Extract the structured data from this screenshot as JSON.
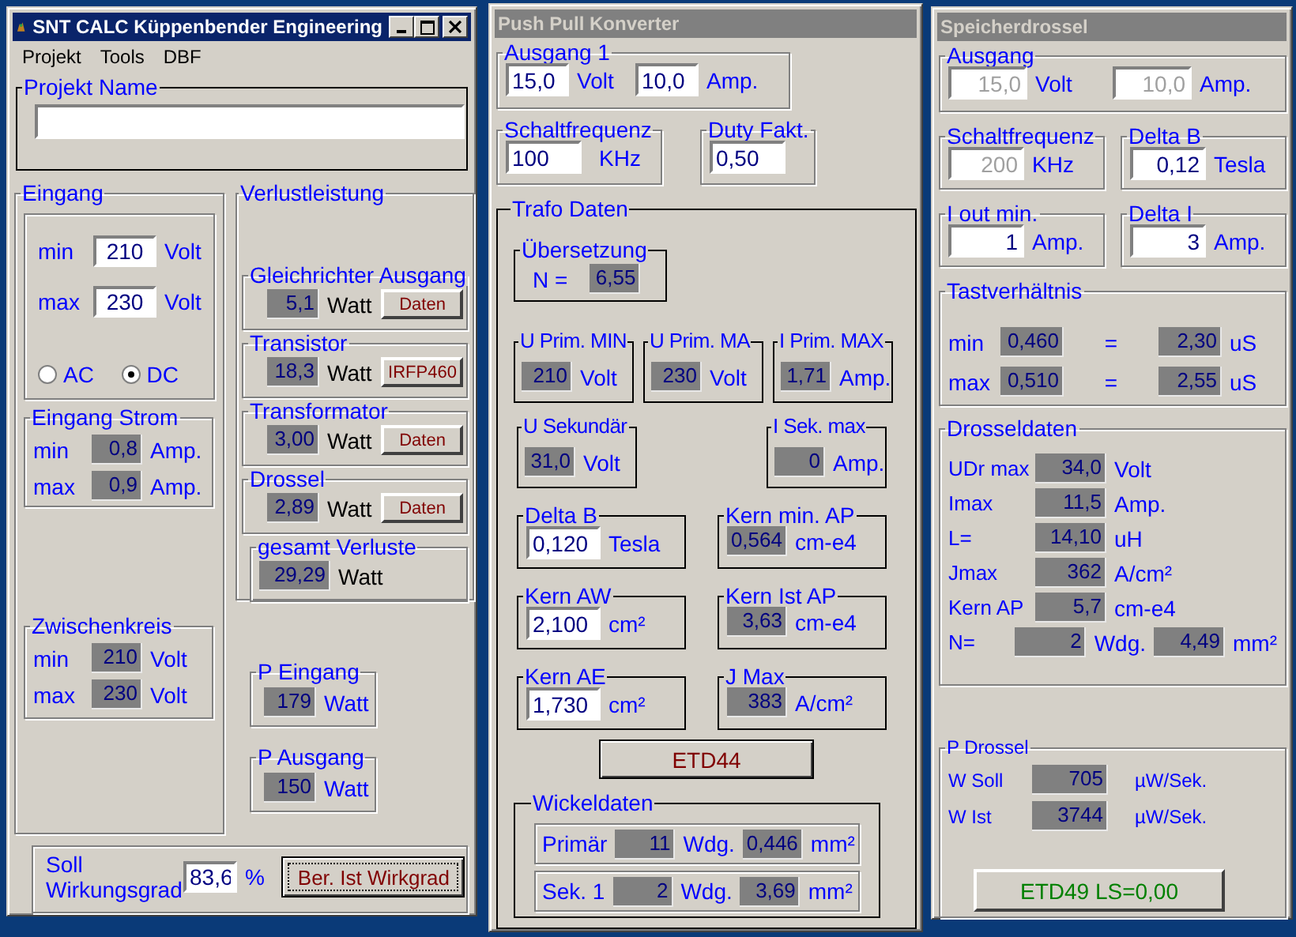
{
  "main_window": {
    "title": "SNT CALC  Küppenbender Engineering",
    "active": true,
    "menu": [
      "Projekt",
      "Tools",
      "DBF"
    ],
    "projekt_name": {
      "title": "Projekt Name"
    },
    "eingang": {
      "title": "Eingang",
      "rows": [
        [
          {
            "kind": "label",
            "text": "min"
          },
          {
            "kind": "input",
            "value": "210",
            "disabled": false
          },
          {
            "kind": "unit",
            "text": "Volt"
          }
        ],
        [
          {
            "kind": "label",
            "text": "max"
          },
          {
            "kind": "input",
            "value": "230",
            "disabled": false
          },
          {
            "kind": "unit",
            "text": "Volt"
          }
        ]
      ],
      "radios": [
        {
          "kind": "radio",
          "text": "AC",
          "selected": false
        },
        {
          "kind": "radio",
          "text": "DC",
          "selected": true
        }
      ]
    },
    "eingang_strom": {
      "title": "Eingang Strom",
      "rows": [
        [
          {
            "kind": "label",
            "text": "min"
          },
          {
            "kind": "output",
            "value": "0,8"
          },
          {
            "kind": "unit",
            "text": "Amp."
          }
        ],
        [
          {
            "kind": "label",
            "text": "max"
          },
          {
            "kind": "output",
            "value": "0,9"
          },
          {
            "kind": "unit",
            "text": "Amp."
          }
        ]
      ]
    },
    "zwischenkreis": {
      "title": "Zwischenkreis",
      "rows": [
        [
          {
            "kind": "label",
            "text": "min"
          },
          {
            "kind": "output",
            "value": "210"
          },
          {
            "kind": "unit",
            "text": "Volt"
          }
        ],
        [
          {
            "kind": "label",
            "text": "max"
          },
          {
            "kind": "output",
            "value": "230"
          },
          {
            "kind": "unit",
            "text": "Volt"
          }
        ]
      ]
    },
    "verlustleistung": {
      "title": "Verlustleistung",
      "groups": [
        {
          "title": "Gleichrichter Ausgang",
          "rows": [
            [
              {
                "kind": "output",
                "value": "5,1"
              },
              {
                "kind": "unit",
                "text": "Watt"
              },
              {
                "kind": "button",
                "text": "Daten",
                "color": "#800000",
                "focused": false
              }
            ]
          ]
        },
        {
          "title": "Transistor",
          "rows": [
            [
              {
                "kind": "output",
                "value": "18,3"
              },
              {
                "kind": "unit",
                "text": "Watt"
              },
              {
                "kind": "button",
                "text": "IRFP460",
                "color": "#800000",
                "focused": false
              }
            ]
          ]
        },
        {
          "title": "Transformator",
          "rows": [
            [
              {
                "kind": "output",
                "value": "3,00"
              },
              {
                "kind": "unit",
                "text": "Watt"
              },
              {
                "kind": "button",
                "text": "Daten",
                "color": "#800000",
                "focused": false
              }
            ]
          ]
        },
        {
          "title": "Drossel",
          "rows": [
            [
              {
                "kind": "output",
                "value": "2,89"
              },
              {
                "kind": "unit",
                "text": "Watt"
              },
              {
                "kind": "button",
                "text": "Daten",
                "color": "#800000",
                "focused": false
              }
            ]
          ]
        },
        {
          "title": "gesamt Verluste",
          "rows": [
            [
              {
                "kind": "output",
                "value": "29,29"
              },
              {
                "kind": "unit",
                "text": "Watt"
              }
            ]
          ]
        }
      ]
    },
    "leistung": [
      {
        "title": "P Eingang",
        "rows": [
          [
            {
              "kind": "output",
              "value": "179"
            },
            {
              "kind": "unit",
              "text": "Watt"
            }
          ]
        ]
      },
      {
        "title": "P Ausgang",
        "rows": [
          [
            {
              "kind": "output",
              "value": "150"
            },
            {
              "kind": "unit",
              "text": "Watt"
            }
          ]
        ]
      }
    ],
    "wirkungsgrad": {
      "rows": [
        [
          {
            "kind": "label",
            "text": "Soll Wirkungsgrad"
          },
          {
            "kind": "input",
            "value": "83,6",
            "disabled": false
          },
          {
            "kind": "unit",
            "text": "%"
          },
          {
            "kind": "button",
            "text": "Ber. Ist Wirkgrad",
            "color": "#800000",
            "focused": true
          }
        ]
      ]
    }
  },
  "push_pull_window": {
    "title": "Push Pull Konverter",
    "active": false,
    "ausgang": {
      "title": "Ausgang 1",
      "rows": [
        [
          {
            "kind": "input",
            "value": "15,0",
            "disabled": false
          },
          {
            "kind": "unit",
            "text": "Volt"
          },
          {
            "kind": "input",
            "value": "10,0",
            "disabled": false
          },
          {
            "kind": "unit",
            "text": "Amp."
          }
        ]
      ]
    },
    "schaltfrequenz": {
      "title": "Schaltfrequenz",
      "rows": [
        [
          {
            "kind": "input",
            "value": "100",
            "disabled": false
          },
          {
            "kind": "unit",
            "text": "KHz"
          }
        ]
      ]
    },
    "duty": {
      "title": "Duty Fakt.",
      "rows": [
        [
          {
            "kind": "input",
            "value": "0,50",
            "disabled": false
          }
        ]
      ]
    },
    "trafo_daten": {
      "title": "Trafo  Daten",
      "uebersetzung": {
        "title": "Übersetzung",
        "rows": [
          [
            {
              "kind": "label",
              "text": "N ="
            },
            {
              "kind": "output",
              "value": "6,55"
            }
          ]
        ]
      },
      "primaer": [
        {
          "title": "U Prim. MIN",
          "rows": [
            [
              {
                "kind": "output",
                "value": "210"
              },
              {
                "kind": "unit",
                "text": "Volt"
              }
            ]
          ]
        },
        {
          "title": "U Prim. MA",
          "rows": [
            [
              {
                "kind": "output",
                "value": "230"
              },
              {
                "kind": "unit",
                "text": "Volt"
              }
            ]
          ]
        },
        {
          "title": "I Prim. MAX",
          "rows": [
            [
              {
                "kind": "output",
                "value": "1,71"
              },
              {
                "kind": "unit",
                "text": "Amp."
              }
            ]
          ]
        }
      ],
      "sekundaer": [
        {
          "title": "U Sekundär",
          "rows": [
            [
              {
                "kind": "output",
                "value": "31,0"
              },
              {
                "kind": "unit",
                "text": "Volt"
              }
            ]
          ]
        },
        {
          "title": "I Sek. max",
          "rows": [
            [
              {
                "kind": "output",
                "value": "0"
              },
              {
                "kind": "unit",
                "text": "Amp."
              }
            ]
          ]
        }
      ],
      "kern": [
        {
          "title": "Delta B",
          "rows": [
            [
              {
                "kind": "input",
                "value": "0,120",
                "disabled": false
              },
              {
                "kind": "unit",
                "text": "Tesla"
              }
            ]
          ]
        },
        {
          "title": "Kern min. AP",
          "rows": [
            [
              {
                "kind": "output",
                "value": "0,564"
              },
              {
                "kind": "unit",
                "text": "cm-e4"
              }
            ]
          ]
        },
        {
          "title": "Kern AW",
          "rows": [
            [
              {
                "kind": "input",
                "value": "2,100",
                "disabled": false
              },
              {
                "kind": "unit",
                "text": "cm²"
              }
            ]
          ]
        },
        {
          "title": "Kern Ist AP",
          "rows": [
            [
              {
                "kind": "output",
                "value": "3,63"
              },
              {
                "kind": "unit",
                "text": "cm-e4"
              }
            ]
          ]
        },
        {
          "title": "Kern AE",
          "rows": [
            [
              {
                "kind": "input",
                "value": "1,730",
                "disabled": false
              },
              {
                "kind": "unit",
                "text": "cm²"
              }
            ]
          ]
        },
        {
          "title": "J Max",
          "rows": [
            [
              {
                "kind": "output",
                "value": "383"
              },
              {
                "kind": "unit",
                "text": "A/cm²"
              }
            ]
          ]
        }
      ],
      "button": {
        "kind": "button",
        "text": "ETD44",
        "color": "#800000",
        "focused": false
      },
      "wickeldaten": {
        "title": "Wickeldaten",
        "rows": [
          [
            {
              "kind": "label",
              "text": "Primär"
            },
            {
              "kind": "output",
              "value": "11"
            },
            {
              "kind": "unit",
              "text": "Wdg."
            },
            {
              "kind": "output",
              "value": "0,446"
            },
            {
              "kind": "unit",
              "text": "mm²"
            }
          ],
          [
            {
              "kind": "label",
              "text": "Sek. 1"
            },
            {
              "kind": "output",
              "value": "2"
            },
            {
              "kind": "unit",
              "text": "Wdg."
            },
            {
              "kind": "output",
              "value": "3,69"
            },
            {
              "kind": "unit",
              "text": "mm²"
            }
          ]
        ]
      }
    }
  },
  "speicherdrossel_window": {
    "title": "Speicherdrossel",
    "active": false,
    "ausgang": {
      "title": "Ausgang",
      "rows": [
        [
          {
            "kind": "input",
            "value": "15,0",
            "disabled": true
          },
          {
            "kind": "unit",
            "text": "Volt"
          },
          {
            "kind": "input",
            "value": "10,0",
            "disabled": true
          },
          {
            "kind": "unit",
            "text": "Amp."
          }
        ]
      ]
    },
    "eingaben": [
      {
        "title": "Schaltfrequenz",
        "rows": [
          [
            {
              "kind": "input",
              "value": "200",
              "disabled": true
            },
            {
              "kind": "unit",
              "text": "KHz"
            }
          ]
        ]
      },
      {
        "title": "Delta B",
        "rows": [
          [
            {
              "kind": "input",
              "value": "0,12",
              "disabled": false
            },
            {
              "kind": "unit",
              "text": "Tesla"
            }
          ]
        ]
      },
      {
        "title": "I out min.",
        "rows": [
          [
            {
              "kind": "input",
              "value": "1",
              "disabled": false
            },
            {
              "kind": "unit",
              "text": "Amp."
            }
          ]
        ]
      },
      {
        "title": "Delta I",
        "rows": [
          [
            {
              "kind": "input",
              "value": "3",
              "disabled": false
            },
            {
              "kind": "unit",
              "text": "Amp."
            }
          ]
        ]
      }
    ],
    "tastverhaeltnis": {
      "title": "Tastverhältnis",
      "rows": [
        [
          {
            "kind": "label",
            "text": "min"
          },
          {
            "kind": "output",
            "value": "0,460"
          },
          {
            "kind": "label",
            "text": "="
          },
          {
            "kind": "output",
            "value": "2,30"
          },
          {
            "kind": "unit",
            "text": "uS"
          }
        ],
        [
          {
            "kind": "label",
            "text": "max"
          },
          {
            "kind": "output",
            "value": "0,510"
          },
          {
            "kind": "label",
            "text": "="
          },
          {
            "kind": "output",
            "value": "2,55"
          },
          {
            "kind": "unit",
            "text": "uS"
          }
        ]
      ]
    },
    "drosseldaten": {
      "title": "Drosseldaten",
      "rows": [
        [
          {
            "kind": "label",
            "text": "UDr max"
          },
          {
            "kind": "output",
            "value": "34,0"
          },
          {
            "kind": "unit",
            "text": "Volt"
          }
        ],
        [
          {
            "kind": "label",
            "text": "Imax"
          },
          {
            "kind": "output",
            "value": "11,5"
          },
          {
            "kind": "unit",
            "text": "Amp."
          }
        ],
        [
          {
            "kind": "label",
            "text": "L="
          },
          {
            "kind": "output",
            "value": "14,10"
          },
          {
            "kind": "unit",
            "text": "uH"
          }
        ],
        [
          {
            "kind": "label",
            "text": "Jmax"
          },
          {
            "kind": "output",
            "value": "362"
          },
          {
            "kind": "unit",
            "text": "A/cm²"
          }
        ],
        [
          {
            "kind": "label",
            "text": "Kern AP"
          },
          {
            "kind": "output",
            "value": "5,7"
          },
          {
            "kind": "unit",
            "text": "cm-e4"
          }
        ],
        [
          {
            "kind": "label",
            "text": "N="
          },
          {
            "kind": "output",
            "value": "2"
          },
          {
            "kind": "unit",
            "text": "Wdg."
          },
          {
            "kind": "output",
            "value": "4,49"
          },
          {
            "kind": "unit",
            "text": "mm²"
          }
        ]
      ]
    },
    "p_drossel": {
      "title": "P Drossel",
      "rows": [
        [
          {
            "kind": "label",
            "text": "W Soll"
          },
          {
            "kind": "output",
            "value": "705"
          },
          {
            "kind": "unit",
            "text": "µW/Sek."
          }
        ],
        [
          {
            "kind": "label",
            "text": "W Ist"
          },
          {
            "kind": "output",
            "value": "3744"
          },
          {
            "kind": "unit",
            "text": "µW/Sek."
          }
        ]
      ],
      "button": {
        "kind": "button",
        "text": "ETD49 LS=0,00",
        "color": "#008000",
        "focused": false
      }
    }
  }
}
